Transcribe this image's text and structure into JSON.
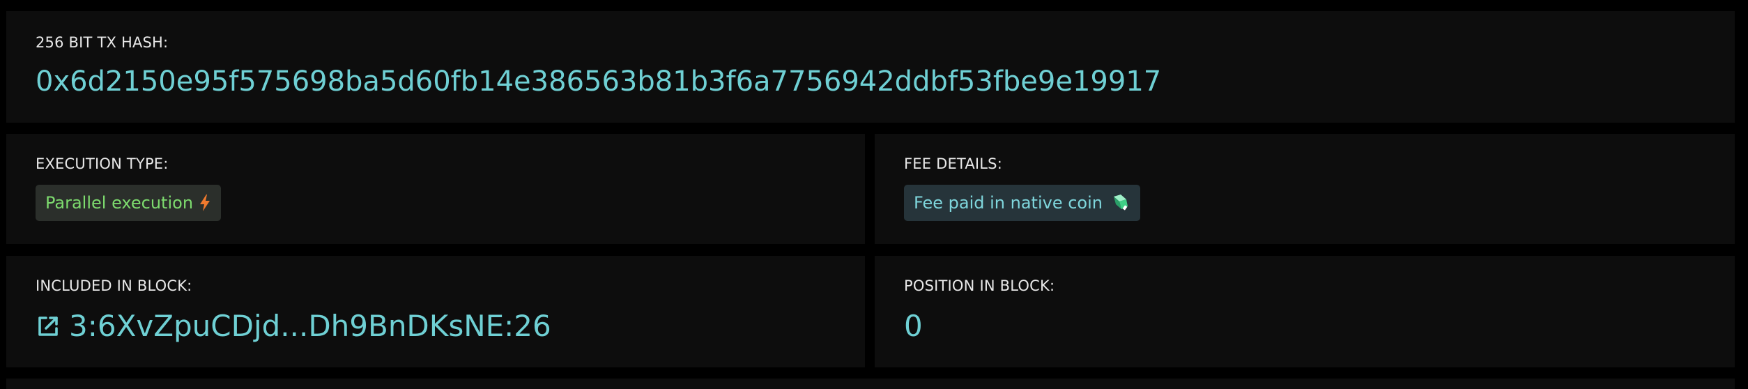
{
  "hash_card": {
    "label": "256 BIT TX HASH:",
    "value": "0x6d2150e95f575698ba5d60fb14e386563b81b3f6a7756942ddbf53fbe9e19917"
  },
  "execution_card": {
    "label": "EXECUTION TYPE:",
    "badge": "Parallel execution",
    "badge_icon": "lightning-icon",
    "badge_color": "#7ddb6e"
  },
  "fee_card": {
    "label": "FEE DETAILS:",
    "badge": "Fee paid in native coin",
    "badge_icon": "native-coin-icon",
    "badge_color": "#7fd6dc"
  },
  "block_card": {
    "label": "INCLUDED IN BLOCK:",
    "value": "3:6XvZpuCDjd...Dh9BnDKsNE:26",
    "icon": "external-link-icon"
  },
  "position_card": {
    "label": "POSITION IN BLOCK:",
    "value": "0"
  },
  "colors": {
    "accent": "#6fd0d4",
    "card_background": "#0d0d0d",
    "page_background": "#000000"
  }
}
